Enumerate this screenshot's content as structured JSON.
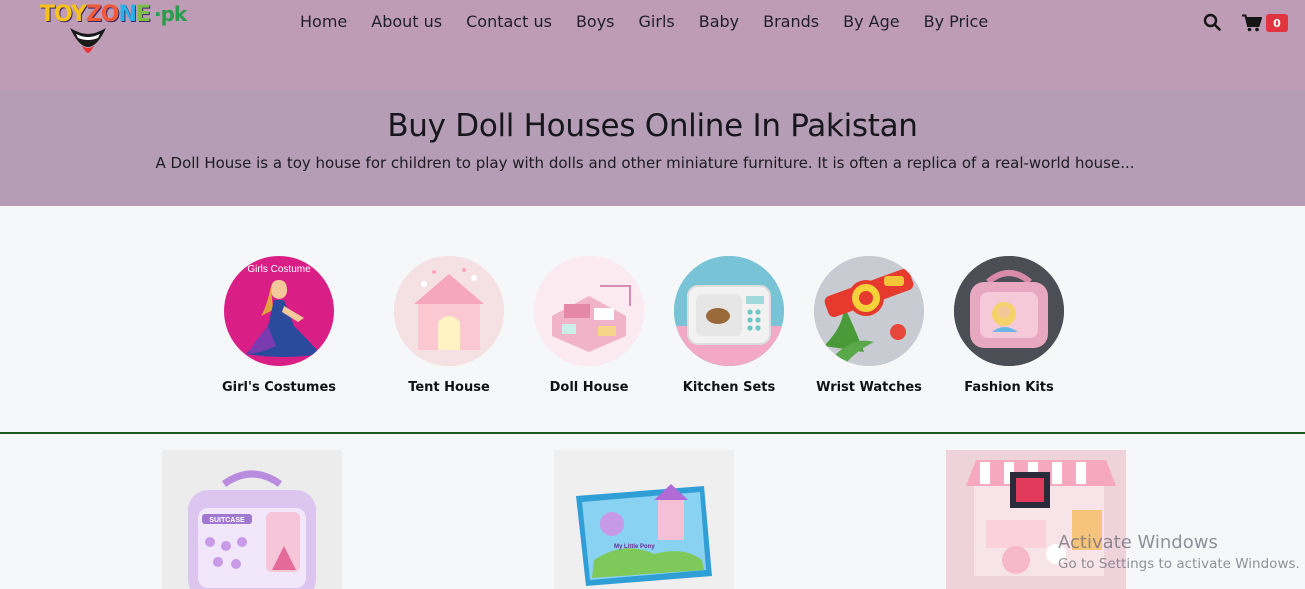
{
  "logo": {
    "text_parts": [
      "TOY",
      "ZO",
      "N",
      "E"
    ],
    "suffix": "·pk",
    "alt": "TOYZONE.pk"
  },
  "nav": {
    "items": [
      "Home",
      "About us",
      "Contact us",
      "Boys",
      "Girls",
      "Baby",
      "Brands",
      "By Age",
      "By Price"
    ]
  },
  "header": {
    "search_icon": "search-icon",
    "cart_icon": "shopping-cart-icon",
    "cart_count": "0"
  },
  "hero": {
    "title": "Buy Doll Houses Online In Pakistan",
    "description": "A Doll House is a toy house for children to play with dolls and other miniature furniture. It is often a replica of a real-world house..."
  },
  "categories": [
    {
      "label": "Girl's Costumes",
      "image_caption": "Girls Costume"
    },
    {
      "label": "Tent House"
    },
    {
      "label": "Doll House"
    },
    {
      "label": "Kitchen Sets"
    },
    {
      "label": "Wrist Watches"
    },
    {
      "label": "Fashion Kits"
    }
  ],
  "products": [
    {
      "image_text": "SUITCASE"
    },
    {
      "image_text": "My Little Pony"
    },
    {
      "image_text": ""
    }
  ],
  "watermark": {
    "line1": "Activate Windows",
    "line2": "Go to Settings to activate Windows."
  },
  "colors": {
    "header_bg": "#be9cb6",
    "hero_bg": "#b49db5",
    "badge": "#e0353f",
    "divider": "#1c5a1c"
  }
}
